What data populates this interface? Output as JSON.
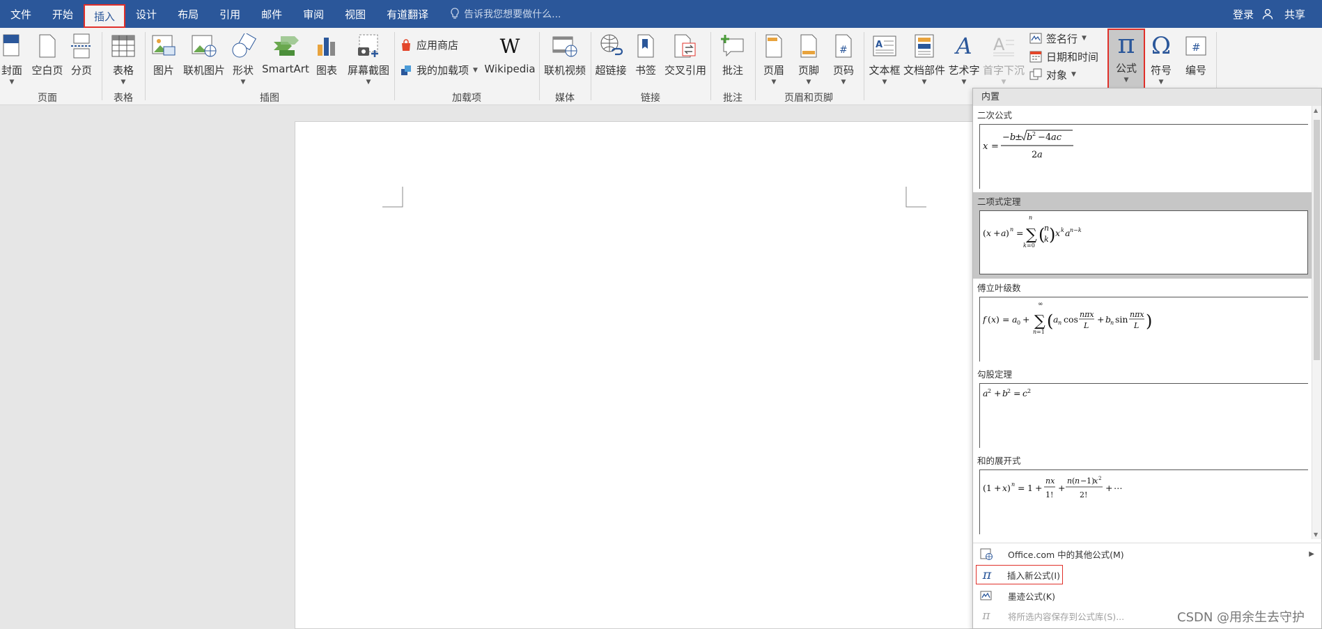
{
  "menubar": {
    "tabs": [
      "文件",
      "开始",
      "插入",
      "设计",
      "布局",
      "引用",
      "邮件",
      "审阅",
      "视图",
      "有道翻译"
    ],
    "active_tab": "插入",
    "tell_me": "告诉我您想要做什么...",
    "login": "登录",
    "share": "共享"
  },
  "ribbon": {
    "buttons": {
      "cover": "封面",
      "blank": "空白页",
      "pagebreak": "分页",
      "table": "表格",
      "picture": "图片",
      "online_picture": "联机图片",
      "shapes": "形状",
      "smartart": "SmartArt",
      "chart": "图表",
      "screenshot": "屏幕截图",
      "store": "应用商店",
      "my_addins": "我的加载项",
      "wikipedia": "Wikipedia",
      "online_video": "联机视频",
      "hyperlink": "超链接",
      "bookmark": "书签",
      "crossref": "交叉引用",
      "comment": "批注",
      "header": "页眉",
      "footer": "页脚",
      "page_number": "页码",
      "textbox": "文本框",
      "quickparts": "文档部件",
      "wordart": "艺术字",
      "dropcap": "首字下沉",
      "signature": "签名行",
      "datetime": "日期和时间",
      "object": "对象",
      "equation": "公式",
      "symbol": "符号",
      "numbering": "编号"
    },
    "groups": {
      "pages": "页面",
      "tables": "表格",
      "illustrations": "插图",
      "addins": "加载项",
      "media": "媒体",
      "links": "链接",
      "comments": "批注",
      "header_footer": "页眉和页脚"
    }
  },
  "equation_panel": {
    "header": "内置",
    "items": [
      {
        "title": "二次公式",
        "formula": "x = (−b ± √(b² − 4ac)) / 2a"
      },
      {
        "title": "二项式定理",
        "formula": "(x + a)ⁿ = Σₖ₌₀ⁿ (n k) xᵏaⁿ⁻ᵏ"
      },
      {
        "title": "傅立叶级数",
        "formula": "f(x) = a₀ + Σₙ₌₁^∞ (aₙ cos nπx/L + bₙ sin nπx/L)"
      },
      {
        "title": "勾股定理",
        "formula": "a² + b² = c²"
      },
      {
        "title": "和的展开式",
        "formula": "(1 + x)ⁿ = 1 + nx/1! + n(n − 1)x²/2! + ⋯"
      }
    ],
    "menu": {
      "more": "Office.com 中的其他公式(M)",
      "insert_new": "插入新公式(I)",
      "ink": "墨迹公式(K)",
      "save": "将所选内容保存到公式库(S)..."
    }
  },
  "watermark": "CSDN @用余生去守护",
  "colors": {
    "title_bar": "#2b579a",
    "highlight": "#e0302a",
    "ribbon_bg": "#f3f3f3"
  }
}
